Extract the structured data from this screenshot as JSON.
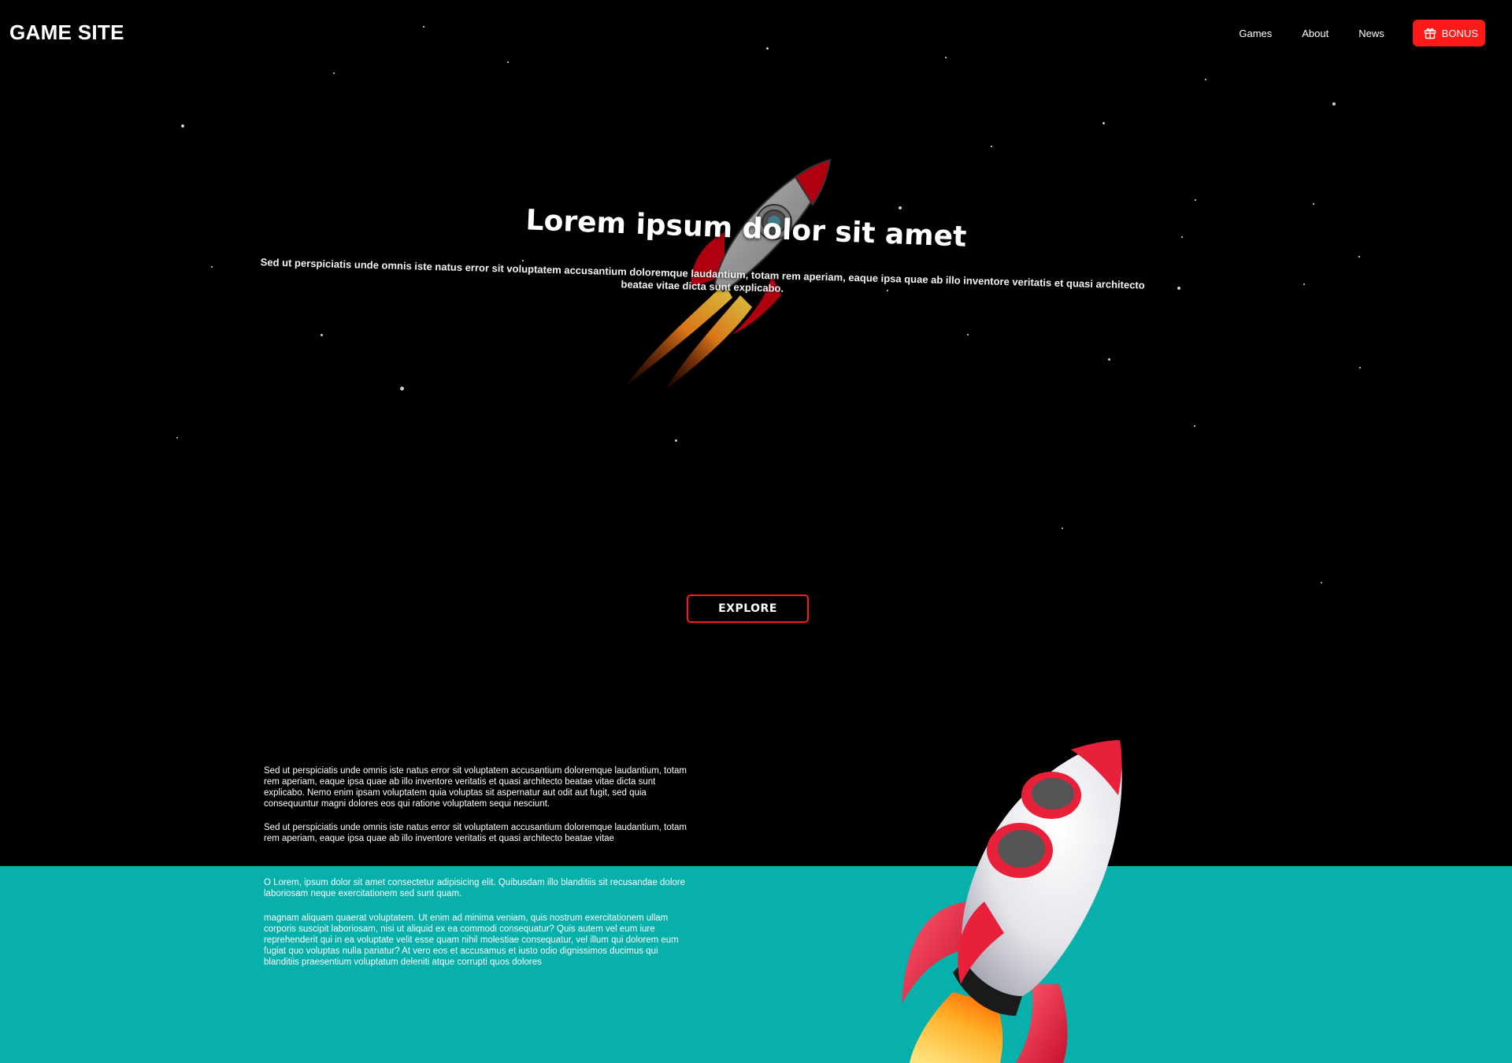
{
  "header": {
    "logo": "GAME SITE",
    "nav": [
      "Games",
      "About",
      "News"
    ],
    "bonus_label": "BONUS"
  },
  "hero": {
    "title": "Lorem ipsum dolor sit amet",
    "subtitle": "Sed ut perspiciatis unde omnis iste natus error sit voluptatem accusantium doloremque laudantium, totam rem aperiam, eaque ipsa quae ab illo inventore veritatis et quasi architecto beatae vitae dicta sunt explicabo.",
    "explore_label": "EXPLORE"
  },
  "about": {
    "paragraphs": [
      "Sed ut perspiciatis unde omnis iste natus error sit voluptatem accusantium doloremque laudantium, totam rem aperiam, eaque ipsa quae ab illo inventore veritatis et quasi architecto beatae vitae dicta sunt explicabo. Nemo enim ipsam voluptatem quia voluptas sit aspernatur aut odit aut fugit, sed quia consequuntur magni dolores eos qui ratione voluptatem sequi nesciunt.",
      "Sed ut perspiciatis unde omnis iste natus error sit voluptatem accusantium doloremque laudantium, totam rem aperiam, eaque ipsa quae ab illo inventore veritatis et quasi architecto beatae vitae",
      "O Lorem, ipsum dolor sit amet consectetur adipisicing elit. Quibusdam illo blanditiis sit recusandae dolore laboriosam neque exercitationem sed sunt quam.",
      "magnam aliquam quaerat voluptatem. Ut enim ad minima veniam, quis nostrum exercitationem ullam corporis suscipit laboriosam, nisi ut aliquid ex ea commodi consequatur? Quis autem vel eum iure reprehenderit qui in ea voluptate velit esse quam nihil molestiae consequatur, vel illum qui dolorem eum fugiat quo voluptas nulla pariatur? At vero eos et accusamus et iusto odio dignissimos ducimus qui blanditiis praesentium voluptatum deleniti atque corrupti quos dolores"
    ]
  },
  "colors": {
    "background": "#000000",
    "accent_red": "#ff1a1a",
    "teal": "#07b0aa",
    "text": "#ffffff"
  },
  "icons": {
    "bonus": "gift-icon",
    "hero": "rocket-illustration",
    "section": "rocket-3d-illustration"
  }
}
